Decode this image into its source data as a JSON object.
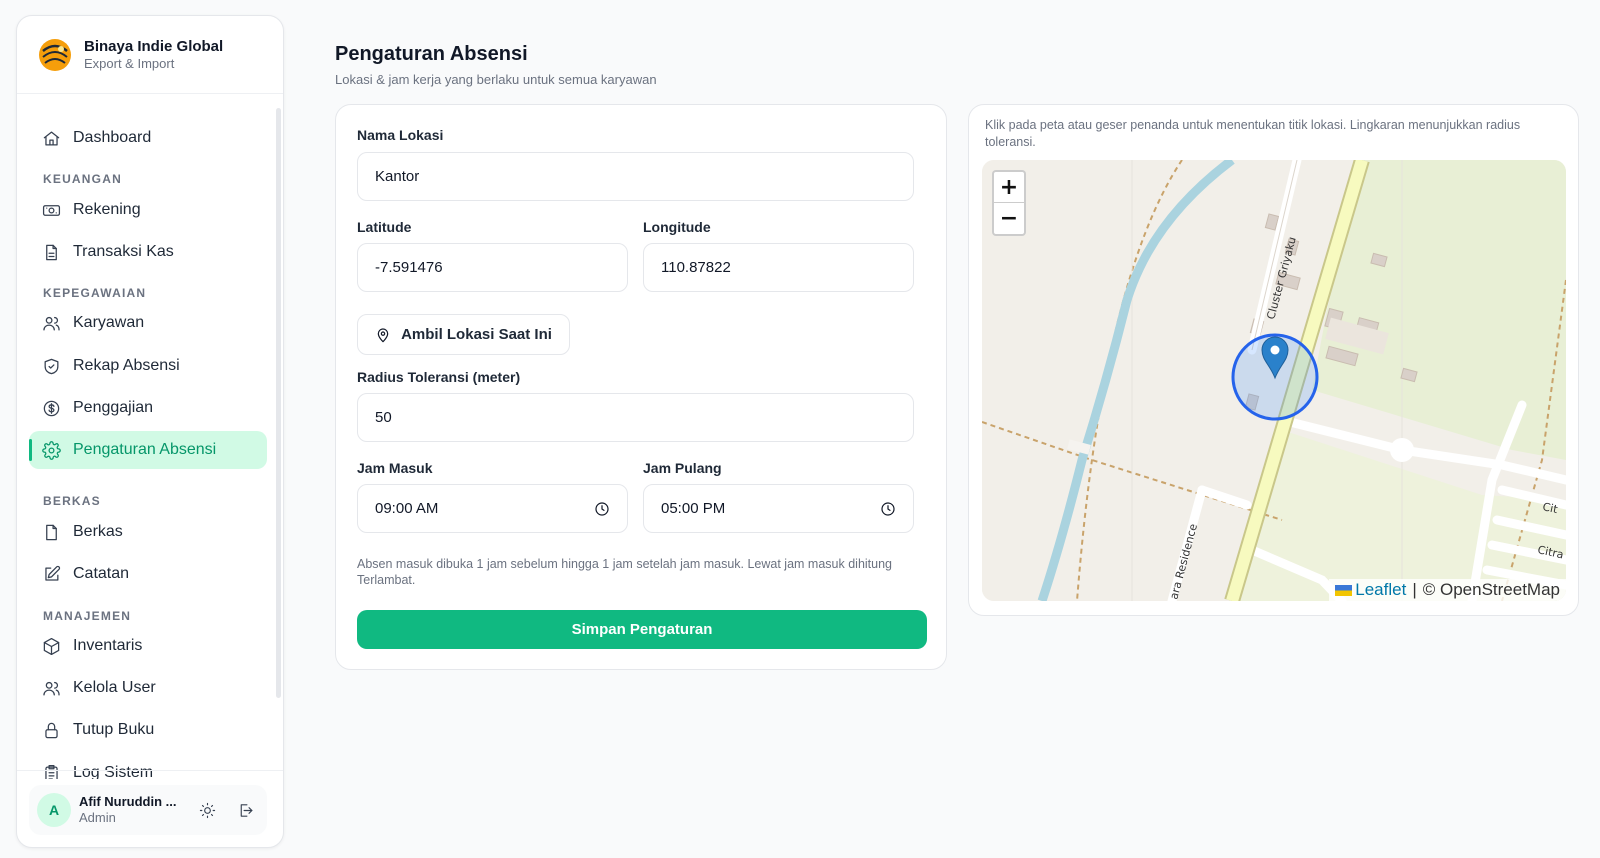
{
  "brand": {
    "name": "Binaya Indie Global",
    "subtitle": "Export & Import"
  },
  "sidebar": {
    "dashboard": "Dashboard",
    "sections": {
      "keuangan": "KEUANGAN",
      "kepegawaian": "KEPEGAWAIAN",
      "berkas": "BERKAS",
      "manajemen": "MANAJEMEN"
    },
    "items": {
      "rekening": "Rekening",
      "transaksi_kas": "Transaksi Kas",
      "karyawan": "Karyawan",
      "rekap_absensi": "Rekap Absensi",
      "penggajian": "Penggajian",
      "pengaturan_absensi": "Pengaturan Absensi",
      "berkas": "Berkas",
      "catatan": "Catatan",
      "inventaris": "Inventaris",
      "kelola_user": "Kelola User",
      "tutup_buku": "Tutup Buku",
      "log_sistem": "Log Sistem"
    },
    "active": "pengaturan_absensi"
  },
  "user": {
    "initial": "A",
    "name": "Afif Nuruddin ...",
    "role": "Admin"
  },
  "page": {
    "title": "Pengaturan Absensi",
    "subtitle": "Lokasi & jam kerja yang berlaku untuk semua karyawan"
  },
  "form": {
    "location_name_label": "Nama Lokasi",
    "location_name_value": "Kantor",
    "latitude_label": "Latitude",
    "latitude_value": "-7.591476",
    "longitude_label": "Longitude",
    "longitude_value": "110.87822",
    "get_location_button": "Ambil Lokasi Saat Ini",
    "radius_label": "Radius Toleransi (meter)",
    "radius_value": "50",
    "check_in_label": "Jam Masuk",
    "check_in_value": "09:00 AM",
    "check_out_label": "Jam Pulang",
    "check_out_value": "05:00 PM",
    "hint": "Absen masuk dibuka 1 jam sebelum hingga 1 jam setelah jam masuk. Lewat jam masuk dihitung Terlambat.",
    "save_button": "Simpan Pengaturan"
  },
  "map": {
    "hint": "Klik pada peta atau geser penanda untuk menentukan titik lokasi. Lingkaran menunjukkan radius toleransi.",
    "zoom_in": "+",
    "zoom_out": "−",
    "attribution_leaflet": "Leaflet",
    "attribution_separator": "|",
    "attribution_osm": "© OpenStreetMap",
    "street_labels": [
      "Cluster Griyaku",
      "ara Residence",
      "Cit",
      "Citra"
    ]
  },
  "colors": {
    "accent": "#10b981",
    "accent_soft": "#d1fae5",
    "accent_text": "#059669",
    "circle": "#2563eb",
    "marker": "#2a81cb"
  }
}
